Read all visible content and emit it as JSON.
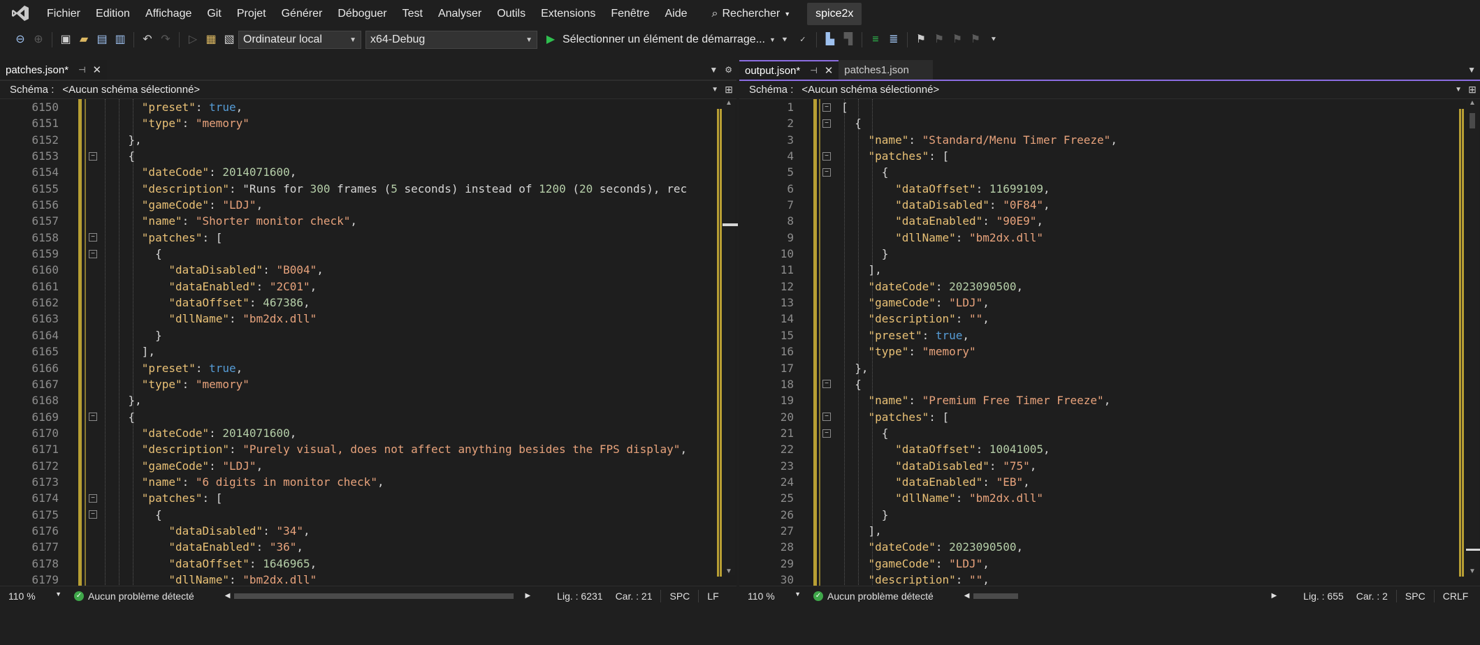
{
  "menu": {
    "items": [
      "Fichier",
      "Edition",
      "Affichage",
      "Git",
      "Projet",
      "Générer",
      "Déboguer",
      "Test",
      "Analyser",
      "Outils",
      "Extensions",
      "Fenêtre",
      "Aide"
    ],
    "search_label": "Rechercher",
    "solution_name": "spice2x"
  },
  "toolbar": {
    "platform": "Ordinateur local",
    "config": "x64-Debug",
    "start_label": "Sélectionner un élément de démarrage..."
  },
  "left": {
    "tab_label": "patches.json*",
    "schema_label": "Schéma :",
    "schema_value": "<Aucun schéma sélectionné>",
    "zoom": "110 %",
    "status_ok": "Aucun problème détecté",
    "line_info": "Lig. : 6231",
    "col_info": "Car. : 21",
    "spc": "SPC",
    "eol": "LF",
    "line_numbers": [
      "6150",
      "6151",
      "6152",
      "6153",
      "6154",
      "6155",
      "6156",
      "6157",
      "6158",
      "6159",
      "6160",
      "6161",
      "6162",
      "6163",
      "6164",
      "6165",
      "6166",
      "6167",
      "6168",
      "6169",
      "6170",
      "6171",
      "6172",
      "6173",
      "6174",
      "6175",
      "6176",
      "6177",
      "6178",
      "6179"
    ]
  },
  "right": {
    "tab_active_label": "output.json*",
    "tab_inactive_label": "patches1.json",
    "schema_label": "Schéma :",
    "schema_value": "<Aucun schéma sélectionné>",
    "zoom": "110 %",
    "status_ok": "Aucun problème détecté",
    "line_info": "Lig. : 655",
    "col_info": "Car. : 2",
    "spc": "SPC",
    "eol": "CRLF",
    "line_numbers": [
      "1",
      "2",
      "3",
      "4",
      "5",
      "6",
      "7",
      "8",
      "9",
      "10",
      "11",
      "12",
      "13",
      "14",
      "15",
      "16",
      "17",
      "18",
      "19",
      "20",
      "21",
      "22",
      "23",
      "24",
      "25",
      "26",
      "27",
      "28",
      "29",
      "30"
    ]
  },
  "left_code": [
    "      \"preset\": true,",
    "      \"type\": \"memory\"",
    "    },",
    "    {",
    "      \"dateCode\": 2014071600,",
    "      \"description\": \"Runs for 300 frames (5 seconds) instead of 1200 (20 seconds), rec",
    "      \"gameCode\": \"LDJ\",",
    "      \"name\": \"Shorter monitor check\",",
    "      \"patches\": [",
    "        {",
    "          \"dataDisabled\": \"B004\",",
    "          \"dataEnabled\": \"2C01\",",
    "          \"dataOffset\": 467386,",
    "          \"dllName\": \"bm2dx.dll\"",
    "        }",
    "      ],",
    "      \"preset\": true,",
    "      \"type\": \"memory\"",
    "    },",
    "    {",
    "      \"dateCode\": 2014071600,",
    "      \"description\": \"Purely visual, does not affect anything besides the FPS display\",",
    "      \"gameCode\": \"LDJ\",",
    "      \"name\": \"6 digits in monitor check\",",
    "      \"patches\": [",
    "        {",
    "          \"dataDisabled\": \"34\",",
    "          \"dataEnabled\": \"36\",",
    "          \"dataOffset\": 1646965,",
    "          \"dllName\": \"bm2dx.dll\""
  ],
  "right_code": [
    "[",
    "  {",
    "    \"name\": \"Standard/Menu Timer Freeze\",",
    "    \"patches\": [",
    "      {",
    "        \"dataOffset\": 11699109,",
    "        \"dataDisabled\": \"0F84\",",
    "        \"dataEnabled\": \"90E9\",",
    "        \"dllName\": \"bm2dx.dll\"",
    "      }",
    "    ],",
    "    \"dateCode\": 2023090500,",
    "    \"gameCode\": \"LDJ\",",
    "    \"description\": \"\",",
    "    \"preset\": true,",
    "    \"type\": \"memory\"",
    "  },",
    "  {",
    "    \"name\": \"Premium Free Timer Freeze\",",
    "    \"patches\": [",
    "      {",
    "        \"dataOffset\": 10041005,",
    "        \"dataDisabled\": \"75\",",
    "        \"dataEnabled\": \"EB\",",
    "        \"dllName\": \"bm2dx.dll\"",
    "      }",
    "    ],",
    "    \"dateCode\": 2023090500,",
    "    \"gameCode\": \"LDJ\",",
    "    \"description\": \"\","
  ]
}
